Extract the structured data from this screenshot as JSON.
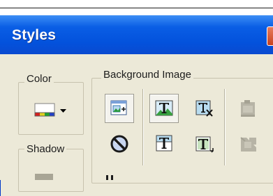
{
  "window": {
    "title": "Styles"
  },
  "groups": {
    "color": {
      "label": "Color"
    },
    "shadow": {
      "label": "Shadow"
    },
    "background_image": {
      "label": "Background Image"
    }
  },
  "toolbar": {
    "icons": [
      "insert-image-icon",
      "no-image-icon",
      "text-over-image-icon",
      "text-image-top-icon",
      "text-clear-background-icon",
      "text-image-tile-icon",
      "image-align-icon",
      "image-stretch-icon"
    ]
  },
  "colors": {
    "accent": "#0352dc",
    "face": "#ece9d8"
  }
}
